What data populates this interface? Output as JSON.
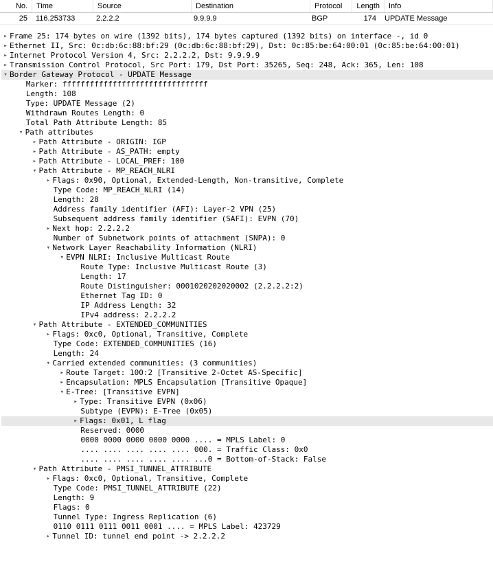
{
  "columns": {
    "no": "No.",
    "time": "Time",
    "source": "Source",
    "destination": "Destination",
    "protocol": "Protocol",
    "length": "Length",
    "info": "Info"
  },
  "packet": {
    "no": "25",
    "time": "116.253733",
    "source": "2.2.2.2",
    "destination": "9.9.9.9",
    "protocol": "BGP",
    "length": "174",
    "info": "UPDATE Message"
  },
  "tree": {
    "frame": "Frame 25: 174 bytes on wire (1392 bits), 174 bytes captured (1392 bits) on interface -, id 0",
    "eth": "Ethernet II, Src: 0c:db:6c:88:bf:29 (0c:db:6c:88:bf:29), Dst: 0c:85:be:64:00:01 (0c:85:be:64:00:01)",
    "ip": "Internet Protocol Version 4, Src: 2.2.2.2, Dst: 9.9.9.9",
    "tcp": "Transmission Control Protocol, Src Port: 179, Dst Port: 35265, Seq: 248, Ack: 365, Len: 108",
    "bgp": "Border Gateway Protocol - UPDATE Message",
    "marker": "Marker: ffffffffffffffffffffffffffffffff",
    "length": "Length: 108",
    "type": "Type: UPDATE Message (2)",
    "withdrawn": "Withdrawn Routes Length: 0",
    "tpal": "Total Path Attribute Length: 85",
    "pathattrs": "Path attributes",
    "origin": "Path Attribute - ORIGIN: IGP",
    "aspath": "Path Attribute - AS_PATH: empty",
    "localpref": "Path Attribute - LOCAL_PREF: 100",
    "mpreach": "Path Attribute - MP_REACH_NLRI",
    "mp_flags": "Flags: 0x90, Optional, Extended-Length, Non-transitive, Complete",
    "mp_typecode": "Type Code: MP_REACH_NLRI (14)",
    "mp_len": "Length: 28",
    "afi": "Address family identifier (AFI): Layer-2 VPN (25)",
    "safi": "Subsequent address family identifier (SAFI): EVPN (70)",
    "nexthop": "Next hop: 2.2.2.2",
    "snpa": "Number of Subnetwork points of attachment (SNPA): 0",
    "nlri": "Network Layer Reachability Information (NLRI)",
    "evpn_nlri": "EVPN NLRI: Inclusive Multicast Route",
    "route_type": "Route Type: Inclusive Multicast Route (3)",
    "route_len": "Length: 17",
    "rd": "Route Distinguisher: 0001020202020002 (2.2.2.2:2)",
    "eth_tag": "Ethernet Tag ID: 0",
    "ip_addr_len": "IP Address Length: 32",
    "ipv4": "IPv4 address: 2.2.2.2",
    "extcomm": "Path Attribute - EXTENDED_COMMUNITIES",
    "ec_flags": "Flags: 0xc0, Optional, Transitive, Complete",
    "ec_typecode": "Type Code: EXTENDED_COMMUNITIES (16)",
    "ec_len": "Length: 24",
    "ec_carried": "Carried extended communities: (3 communities)",
    "rt": "Route Target: 100:2 [Transitive 2-Octet AS-Specific]",
    "encap": "Encapsulation: MPLS Encapsulation [Transitive Opaque]",
    "etree": "E-Tree: [Transitive EVPN]",
    "etree_type": "Type: Transitive EVPN (0x06)",
    "etree_subtype": "Subtype (EVPN): E-Tree (0x05)",
    "etree_flags": "Flags: 0x01, L flag",
    "etree_reserved": "Reserved: 0000",
    "etree_mpls": "0000 0000 0000 0000 0000 .... = MPLS Label: 0",
    "etree_tc": ".... .... .... .... .... 000. = Traffic Class: 0x0",
    "etree_bos": ".... .... .... .... .... ...0 = Bottom-of-Stack: False",
    "pmsi": "Path Attribute - PMSI_TUNNEL_ATTRIBUTE",
    "pmsi_flags_hdr": "Flags: 0xc0, Optional, Transitive, Complete",
    "pmsi_typecode": "Type Code: PMSI_TUNNEL_ATTRIBUTE (22)",
    "pmsi_len": "Length: 9",
    "pmsi_flags0": "Flags: 0",
    "pmsi_tunneltype": "Tunnel Type: Ingress Replication (6)",
    "pmsi_mpls": "0110 0111 0111 0011 0001 .... = MPLS Label: 423729",
    "pmsi_tunnelid": "Tunnel ID: tunnel end point -> 2.2.2.2"
  }
}
